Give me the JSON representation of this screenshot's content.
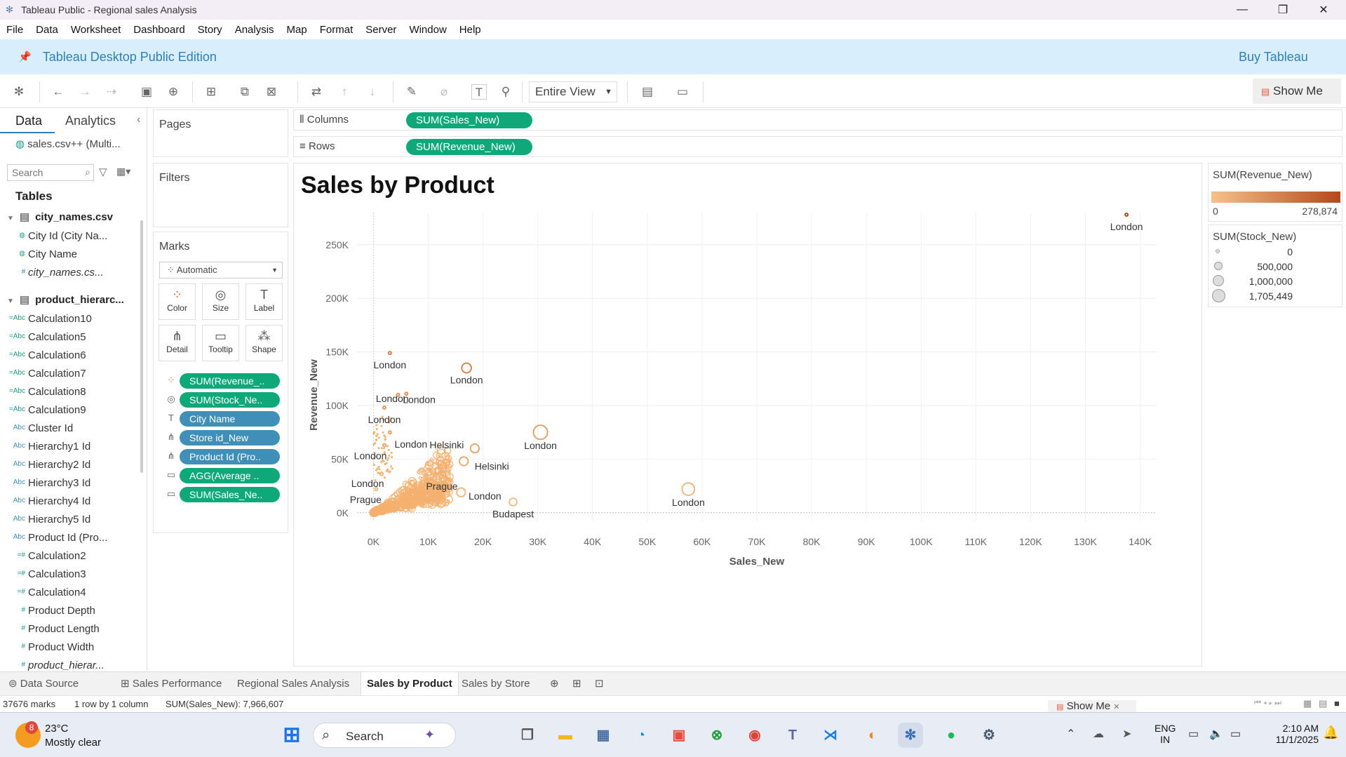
{
  "window": {
    "title": "Tableau Public - Regional sales Analysis"
  },
  "menu": [
    "File",
    "Data",
    "Worksheet",
    "Dashboard",
    "Story",
    "Analysis",
    "Map",
    "Format",
    "Server",
    "Window",
    "Help"
  ],
  "banner": {
    "edition": "Tableau Desktop Public Edition",
    "buy": "Buy Tableau"
  },
  "toolbar": {
    "view_mode": "Entire View",
    "show_me": "Show Me"
  },
  "left": {
    "tab_data": "Data",
    "tab_analytics": "Analytics",
    "datasource": "sales.csv++ (Multi...",
    "search_placeholder": "Search",
    "tables_heading": "Tables",
    "table1": "city_names.csv",
    "table1_fields": [
      "City Id (City Na...",
      "City Name",
      "city_names.cs..."
    ],
    "table2": "product_hierarc...",
    "table2_fields": [
      "Calculation10",
      "Calculation5",
      "Calculation6",
      "Calculation7",
      "Calculation8",
      "Calculation9",
      "Cluster Id",
      "Hierarchy1 Id",
      "Hierarchy2 Id",
      "Hierarchy3 Id",
      "Hierarchy4 Id",
      "Hierarchy5 Id",
      "Product Id (Pro...",
      "Calculation2",
      "Calculation3",
      "Calculation4",
      "Product Depth",
      "Product Length",
      "Product Width",
      "product_hierar..."
    ]
  },
  "cards": {
    "pages": "Pages",
    "filters": "Filters",
    "marks": "Marks",
    "mark_type": "Automatic",
    "buttons": [
      "Color",
      "Size",
      "Label",
      "Detail",
      "Tooltip",
      "Shape"
    ],
    "mark_pills": [
      "SUM(Revenue_..",
      "SUM(Stock_Ne..",
      "City Name",
      "Store id_New",
      "Product Id (Pro..",
      "AGG(Average ..",
      "SUM(Sales_Ne.."
    ]
  },
  "shelves": {
    "columns_label": "Columns",
    "columns_pill": "SUM(Sales_New)",
    "rows_label": "Rows",
    "rows_pill": "SUM(Revenue_New)"
  },
  "legend_color": {
    "title": "SUM(Revenue_New)",
    "min": "0",
    "max": "278,874",
    "from": "#f5c28a",
    "to": "#b5481c"
  },
  "legend_size": {
    "title": "SUM(Stock_New)",
    "items": [
      "0",
      "500,000",
      "1,000,000",
      "1,705,449"
    ]
  },
  "chart_data": {
    "type": "scatter",
    "title": "Sales by Product",
    "xlabel": "Sales_New",
    "ylabel": "Revenue_New",
    "xlim": [
      -3000,
      143000
    ],
    "ylim": [
      -8000,
      280000
    ],
    "x_ticks": [
      "0K",
      "10K",
      "20K",
      "30K",
      "40K",
      "50K",
      "60K",
      "70K",
      "80K",
      "90K",
      "100K",
      "110K",
      "120K",
      "130K",
      "140K"
    ],
    "x_tick_values": [
      0,
      10000,
      20000,
      30000,
      40000,
      50000,
      60000,
      70000,
      80000,
      90000,
      100000,
      110000,
      120000,
      130000,
      140000
    ],
    "y_ticks": [
      "0K",
      "50K",
      "100K",
      "150K",
      "200K",
      "250K"
    ],
    "y_tick_values": [
      0,
      50000,
      100000,
      150000,
      200000,
      250000
    ],
    "labeled_points": [
      {
        "x": 137500,
        "y": 278000,
        "label": "London",
        "size": 0
      },
      {
        "x": 3000,
        "y": 149000,
        "label": "London",
        "size": 0
      },
      {
        "x": 17000,
        "y": 135000,
        "label": "London",
        "size": 400000
      },
      {
        "x": 6000,
        "y": 111000,
        "label": "London",
        "size": 0
      },
      {
        "x": 4500,
        "y": 110000,
        "label": "London",
        "size": 0
      },
      {
        "x": 2000,
        "y": 98000,
        "label": "London",
        "size": 0
      },
      {
        "x": 3000,
        "y": 75000,
        "label": "London",
        "size": 0
      },
      {
        "x": 30500,
        "y": 75000,
        "label": "London",
        "size": 1100000
      },
      {
        "x": 2000,
        "y": 63000,
        "label": "London",
        "size": 0
      },
      {
        "x": 18500,
        "y": 60000,
        "label": "Helsinki",
        "size": 300000
      },
      {
        "x": 16500,
        "y": 48000,
        "label": "Helsinki",
        "size": 300000
      },
      {
        "x": 1500,
        "y": 36000,
        "label": "London",
        "size": 0
      },
      {
        "x": 12500,
        "y": 36000,
        "label": "Prague",
        "size": 200000
      },
      {
        "x": 500,
        "y": 22000,
        "label": "Prague",
        "size": 0
      },
      {
        "x": 16000,
        "y": 19000,
        "label": "London",
        "size": 300000
      },
      {
        "x": 57500,
        "y": 22000,
        "label": "London",
        "size": 800000
      },
      {
        "x": 25500,
        "y": 10000,
        "label": "Budapest",
        "size": 200000
      }
    ],
    "other_points_note": "",
    "grid": true
  },
  "sheets": {
    "tabs": [
      "Data Source",
      "Sales Performance",
      "Regional Sales Analysis",
      "Sales by Product",
      "Sales by Store"
    ],
    "active": 3
  },
  "status": {
    "marks": "37676 marks",
    "dims": "1 row by 1 column",
    "sum": "SUM(Sales_New): 7,966,607",
    "showme": "Show Me"
  },
  "taskbar": {
    "weather_temp": "23°C",
    "weather_desc": "Mostly clear",
    "weather_badge": "8",
    "search": "Search",
    "lang1": "ENG",
    "lang2": "IN",
    "time": "2:10 AM",
    "date": "11/1/2025"
  }
}
